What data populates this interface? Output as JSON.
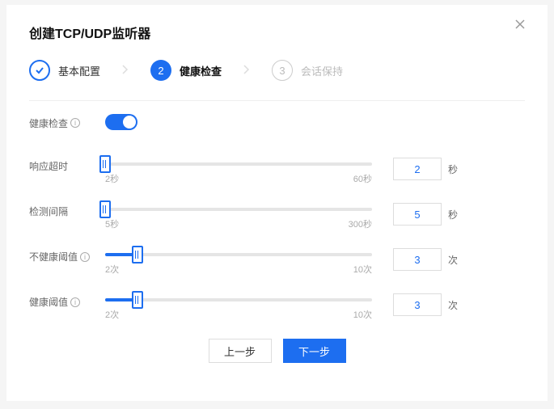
{
  "title": "创建TCP/UDP监听器",
  "steps": [
    {
      "label": "基本配置",
      "state": "done"
    },
    {
      "label": "健康检查",
      "state": "active",
      "num": "2"
    },
    {
      "label": "会话保持",
      "state": "pending",
      "num": "3"
    }
  ],
  "healthcheck_toggle": {
    "label": "健康检查",
    "on": true
  },
  "sliders": [
    {
      "key": "response_timeout",
      "label": "响应超时",
      "info": false,
      "min_label": "2秒",
      "max_label": "60秒",
      "value": "2",
      "unit": "秒",
      "fill_pct": 0,
      "handle_pct": 0
    },
    {
      "key": "check_interval",
      "label": "检测间隔",
      "info": false,
      "min_label": "5秒",
      "max_label": "300秒",
      "value": "5",
      "unit": "秒",
      "fill_pct": 0,
      "handle_pct": 0
    },
    {
      "key": "unhealthy_threshold",
      "label": "不健康阈值",
      "info": true,
      "min_label": "2次",
      "max_label": "10次",
      "value": "3",
      "unit": "次",
      "fill_pct": 12,
      "handle_pct": 12
    },
    {
      "key": "healthy_threshold",
      "label": "健康阈值",
      "info": true,
      "min_label": "2次",
      "max_label": "10次",
      "value": "3",
      "unit": "次",
      "fill_pct": 12,
      "handle_pct": 12
    }
  ],
  "buttons": {
    "prev": "上一步",
    "next": "下一步"
  }
}
